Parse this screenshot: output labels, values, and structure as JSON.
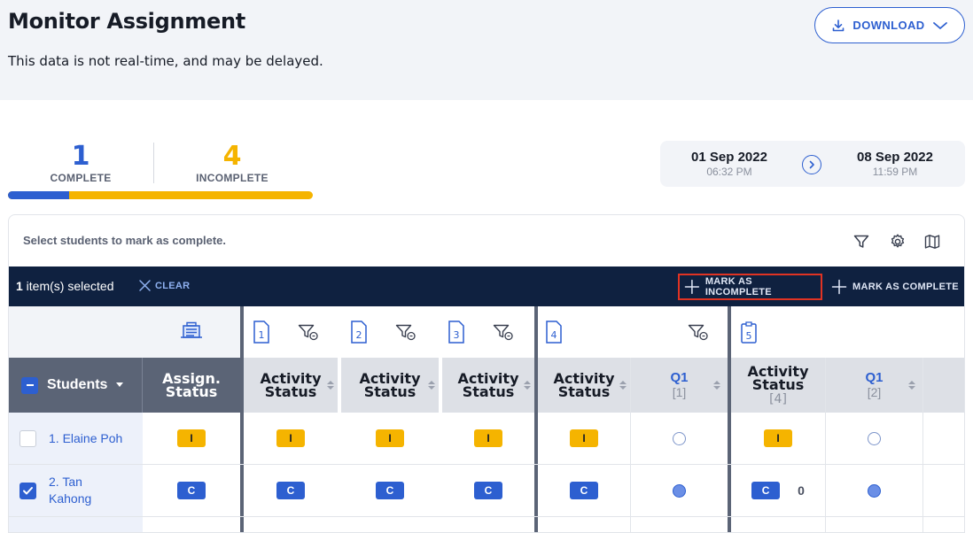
{
  "header": {
    "title": "Monitor Assignment",
    "subtitle": "This data is not real-time, and may be delayed.",
    "download_label": "DOWNLOAD"
  },
  "summary": {
    "complete_count": "1",
    "complete_label": "COMPLETE",
    "incomplete_count": "4",
    "incomplete_label": "INCOMPLETE",
    "complete_fraction": 0.2
  },
  "dates": {
    "start_date": "01 Sep 2022",
    "start_time": "06:32 PM",
    "end_date": "08 Sep 2022",
    "end_time": "11:59 PM"
  },
  "panel": {
    "hint": "Select students to mark as complete.",
    "tools": [
      "filter-icon",
      "settings-icon",
      "map-icon"
    ]
  },
  "action_bar": {
    "selected_count": "1",
    "selected_text": " item(s) selected",
    "clear_label": "CLEAR",
    "mark_incomplete_label": "MARK AS INCOMPLETE",
    "mark_complete_label": "MARK AS COMPLETE"
  },
  "table": {
    "activity_numbers": [
      "1",
      "2",
      "3",
      "4",
      "5"
    ],
    "students_header": "Students",
    "assign_status_header": "Assign. Status",
    "activity_status_header": "Activity Status",
    "activity_status_5_sub": "[4]",
    "q1_header": "Q1",
    "q1_sub_a": "[1]",
    "q1_sub_b": "[2]",
    "rows": [
      {
        "name": "1. Elaine Poh",
        "checked": false,
        "assign": "I",
        "a1": "I",
        "a2": "I",
        "a3": "I",
        "a4": "I",
        "q1a": "empty",
        "a5": "I",
        "q1b": "empty"
      },
      {
        "name": "2. Tan Kahong",
        "checked": true,
        "assign": "C",
        "a1": "C",
        "a2": "C",
        "a3": "C",
        "a4": "C",
        "q1a": "full",
        "a5": "C",
        "a5_score": "0",
        "q1b": "full"
      }
    ]
  },
  "colors": {
    "accent": "#2d5fd0",
    "complete": "#2d5fd0",
    "incomplete": "#f5b400",
    "action_bar": "#0f2140",
    "highlight": "#e03323"
  }
}
